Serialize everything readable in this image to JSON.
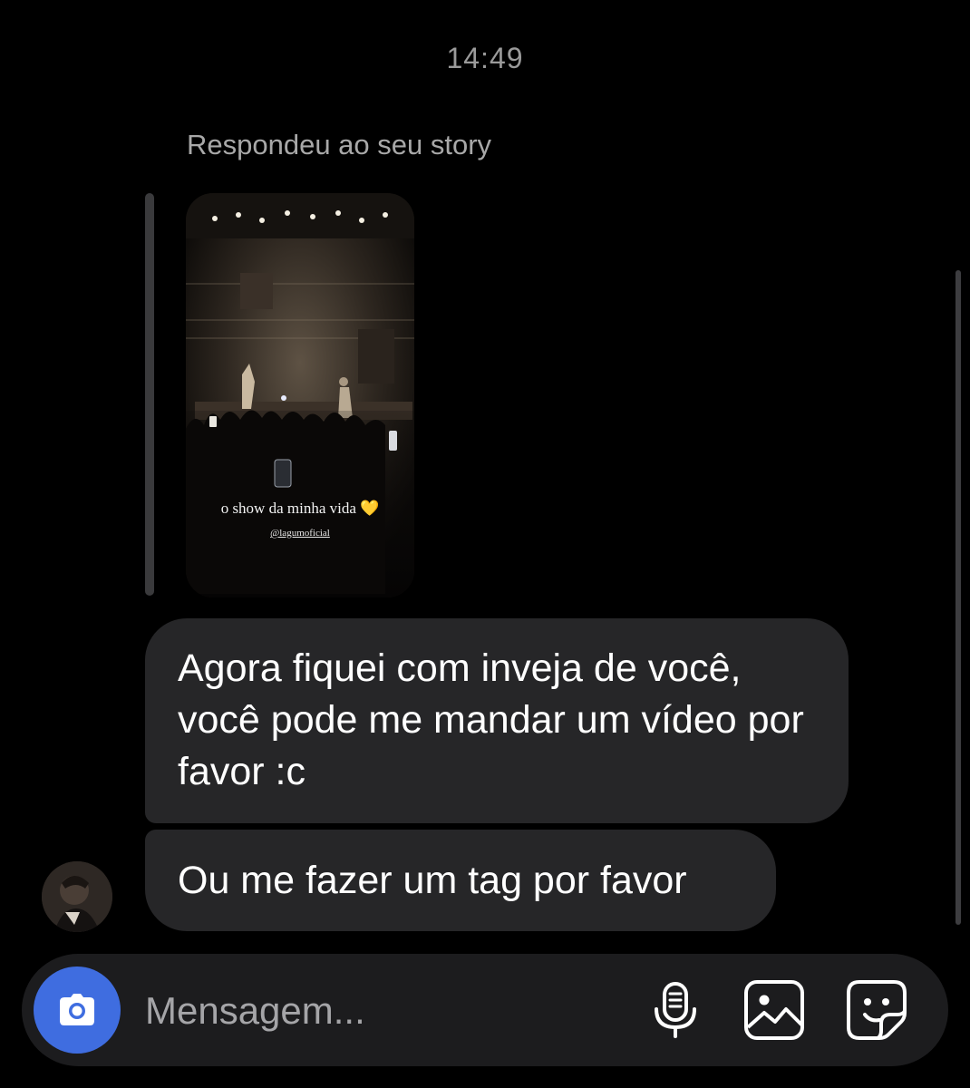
{
  "chat": {
    "timestamp": "14:49",
    "reply_context": "Respondeu ao seu story",
    "story": {
      "caption": "o show da minha vida 💛",
      "mention": "@lagumoficial"
    },
    "messages": [
      {
        "text": "Agora fiquei com inveja de você, você pode me mandar um vídeo por favor :c"
      },
      {
        "text": "Ou me fazer um tag por favor"
      }
    ]
  },
  "composer": {
    "placeholder": "Mensagem...",
    "camera_icon": "camera-icon",
    "mic_icon": "microphone-icon",
    "gallery_icon": "gallery-icon",
    "sticker_icon": "sticker-icon",
    "accent_color": "#3f6de0"
  },
  "theme": {
    "background": "#000000",
    "bubble": "#262628"
  }
}
